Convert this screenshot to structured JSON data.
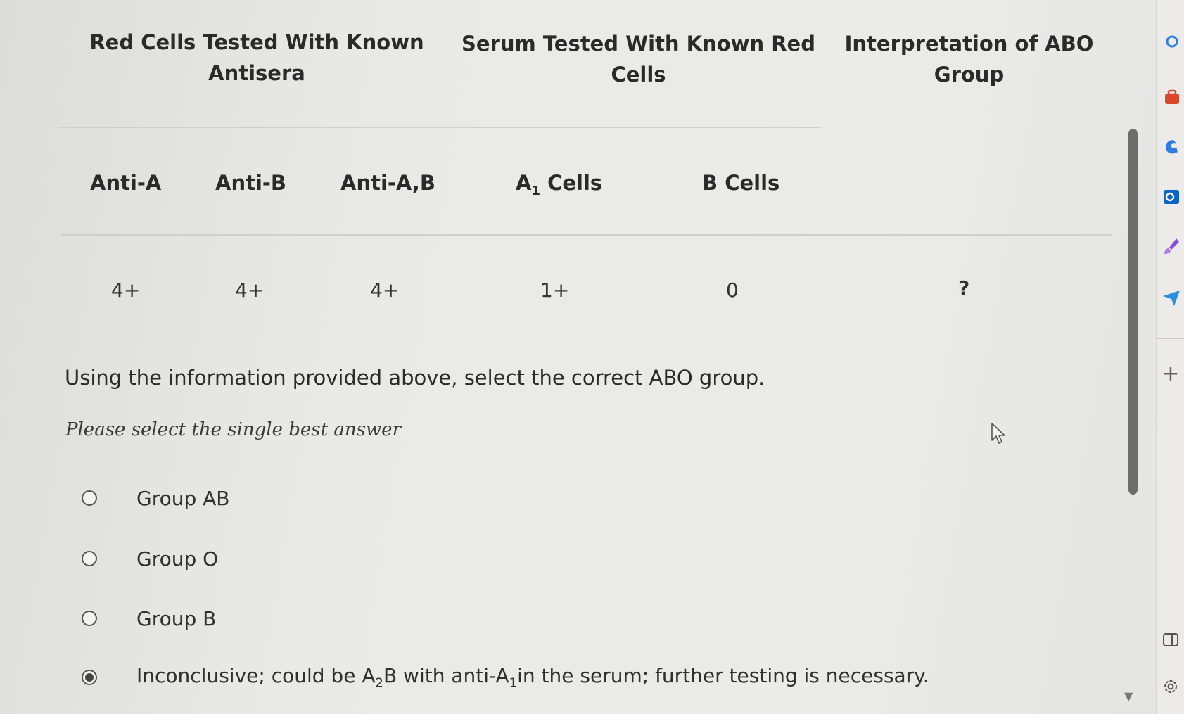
{
  "table": {
    "group_headers": {
      "red_cells": [
        "Red Cells Tested With Known",
        "Antisera"
      ],
      "serum": [
        "Serum Tested With Known Red",
        "Cells"
      ],
      "interpretation": [
        "Interpretation of ABO",
        "Group"
      ]
    },
    "columns": {
      "anti_a": "Anti-A",
      "anti_b": "Anti-B",
      "anti_ab": "Anti-A,B",
      "a1_cells_main": "A",
      "a1_cells_sub": "1",
      "a1_cells_rest": " Cells",
      "b_cells": "B Cells"
    },
    "row": {
      "anti_a": "4+",
      "anti_b": "4+",
      "anti_ab": "4+",
      "a1_cells": "1+",
      "b_cells": "0",
      "interpretation": "?"
    }
  },
  "question": "Using the information provided above, select the correct ABO group.",
  "instruction": "Please select the single best answer",
  "options": [
    {
      "label": "Group AB",
      "selected": false
    },
    {
      "label": "Group O",
      "selected": false
    },
    {
      "label": "Group B",
      "selected": false
    },
    {
      "label_part1": "Inconclusive; could be A",
      "label_sub1": "2",
      "label_part2": "B with anti-A",
      "label_sub2": "1",
      "label_part3": "in the serum; further testing is necessary.",
      "selected": true
    }
  ],
  "sidebar": {
    "icons": [
      "search-icon",
      "briefcase-icon",
      "copilot-icon",
      "outlook-icon",
      "brush-icon",
      "send-icon",
      "add-icon",
      "split-view-icon",
      "settings-icon"
    ],
    "add_glyph": "+"
  },
  "colors": {
    "accent_blue": "#1f6fd1",
    "briefcase_red": "#d9482b",
    "outlook_blue": "#0a64c8",
    "brush_purple": "#8a4fd8"
  }
}
